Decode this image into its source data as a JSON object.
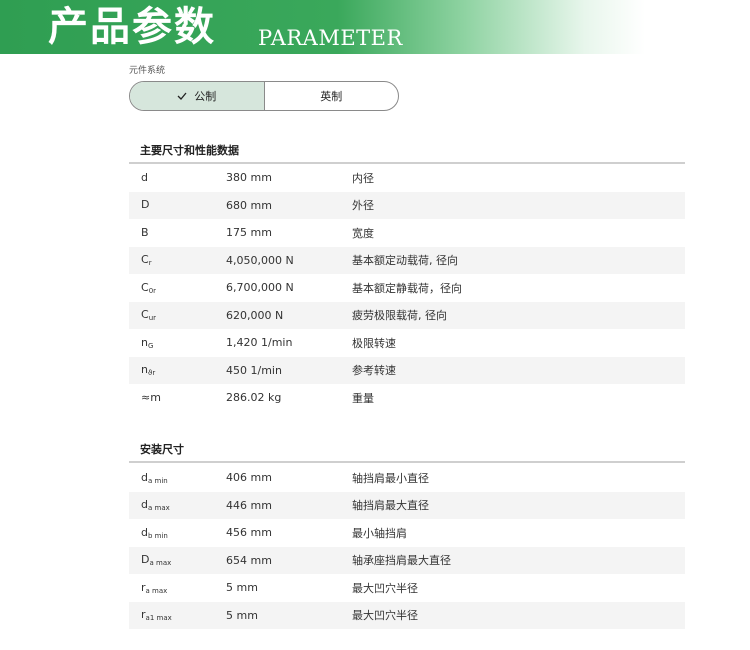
{
  "banner": {
    "title": "产品参数",
    "subtitle": "PARAMETER"
  },
  "unit_system": {
    "label": "元件系统",
    "options": [
      {
        "label": "公制",
        "selected": true
      },
      {
        "label": "英制",
        "selected": false
      }
    ]
  },
  "main_dimensions": {
    "title": "主要尺寸和性能数据",
    "rows": [
      {
        "sym": "d",
        "sub": "",
        "value": "380 mm",
        "desc": "内径"
      },
      {
        "sym": "D",
        "sub": "",
        "value": "680 mm",
        "desc": "外径"
      },
      {
        "sym": "B",
        "sub": "",
        "value": "175 mm",
        "desc": "宽度"
      },
      {
        "sym": "C",
        "sub": "r",
        "value": "4,050,000 N",
        "desc": "基本额定动载荷, 径向"
      },
      {
        "sym": "C",
        "sub": "0r",
        "value": "6,700,000 N",
        "desc": "基本额定静载荷，径向"
      },
      {
        "sym": "C",
        "sub": "ur",
        "value": "620,000 N",
        "desc": "疲劳极限载荷, 径向"
      },
      {
        "sym": "n",
        "sub": "G",
        "value": "1,420 1/min",
        "desc": "极限转速"
      },
      {
        "sym": "n",
        "sub": "ϑr",
        "value": "450 1/min",
        "desc": "参考转速"
      },
      {
        "sym": "≈m",
        "sub": "",
        "value": "286.02 kg",
        "desc": "重量"
      }
    ]
  },
  "mounting_dimensions": {
    "title": "安装尺寸",
    "rows": [
      {
        "sym": "d",
        "sub": "a min",
        "value": "406 mm",
        "desc": "轴挡肩最小直径"
      },
      {
        "sym": "d",
        "sub": "a max",
        "value": "446 mm",
        "desc": "轴挡肩最大直径"
      },
      {
        "sym": "d",
        "sub": "b min",
        "value": "456 mm",
        "desc": "最小轴挡肩"
      },
      {
        "sym": "D",
        "sub": "a max",
        "value": "654 mm",
        "desc": "轴承座挡肩最大直径"
      },
      {
        "sym": "r",
        "sub": "a max",
        "value": "5 mm",
        "desc": "最大凹穴半径"
      },
      {
        "sym": "r",
        "sub": "a1 max",
        "value": "5 mm",
        "desc": "最大凹穴半径"
      }
    ]
  }
}
